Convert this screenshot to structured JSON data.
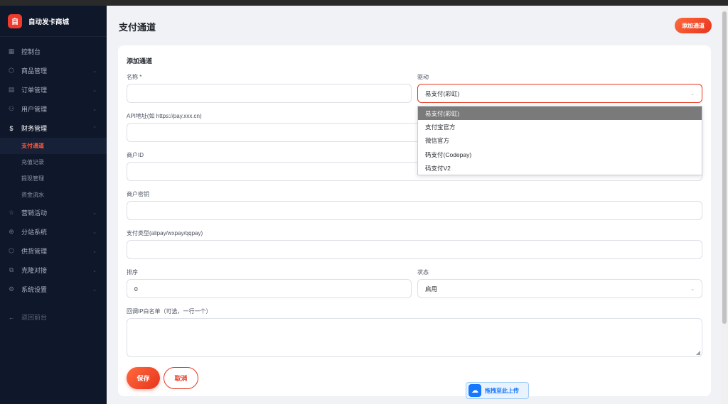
{
  "brand": {
    "logo_char": "自",
    "name": "自动发卡商城"
  },
  "sidebar": {
    "items": [
      {
        "icon": "dashboard-icon",
        "glyph": "▦",
        "label": "控制台",
        "chevron": ""
      },
      {
        "icon": "product-icon",
        "glyph": "⬡",
        "label": "商品管理",
        "chevron": "⌄"
      },
      {
        "icon": "order-icon",
        "glyph": "▤",
        "label": "订单管理",
        "chevron": "⌄"
      },
      {
        "icon": "user-icon",
        "glyph": "⚇",
        "label": "用户管理",
        "chevron": "⌄"
      },
      {
        "icon": "finance-icon",
        "glyph": "$",
        "label": "财务管理",
        "chevron": "⌃"
      },
      {
        "icon": "marketing-icon",
        "glyph": "☆",
        "label": "营销活动",
        "chevron": "⌄"
      },
      {
        "icon": "substation-icon",
        "glyph": "⊕",
        "label": "分站系统",
        "chevron": "⌄"
      },
      {
        "icon": "supply-icon",
        "glyph": "⬡",
        "label": "供货管理",
        "chevron": "⌄"
      },
      {
        "icon": "clone-icon",
        "glyph": "⧉",
        "label": "克隆对接",
        "chevron": "⌄"
      },
      {
        "icon": "settings-icon",
        "glyph": "⚙",
        "label": "系统设置",
        "chevron": "⌄"
      }
    ],
    "finance_sub": [
      "支付通道",
      "充值记录",
      "提现管理",
      "资金流水"
    ],
    "back": {
      "glyph": "←",
      "label": "返回前台"
    }
  },
  "header": {
    "title": "支付通道",
    "add_button": "添加通道"
  },
  "form": {
    "title": "添加通道",
    "name_label": "名称 *",
    "name_value": "",
    "driver_label": "驱动",
    "driver_value": "易支付(彩虹)",
    "driver_options": [
      "易支付(彩虹)",
      "支付宝官方",
      "微信官方",
      "码支付(Codepay)",
      "码支付V2"
    ],
    "api_label": "API地址(如 https://pay.xxx.cn)",
    "api_value": "",
    "merchant_id_label": "商户ID",
    "merchant_id_value": "",
    "merchant_key_label": "商户密钥",
    "merchant_key_value": "",
    "pay_type_label": "支付类型(alipay/wxpay/qqpay)",
    "pay_type_value": "",
    "sort_label": "排序",
    "sort_value": "0",
    "status_label": "状态",
    "status_value": "启用",
    "whitelist_label": "回调IP白名单（可选，一行一个）",
    "save": "保存",
    "cancel": "取消"
  },
  "upload_widget": {
    "label": "拖拽至此上传"
  },
  "colors": {
    "accent": "#e8341c",
    "sidebar_bg": "#0f172a",
    "page_bg": "#f0f2f5",
    "upload_blue": "#1677ff"
  }
}
